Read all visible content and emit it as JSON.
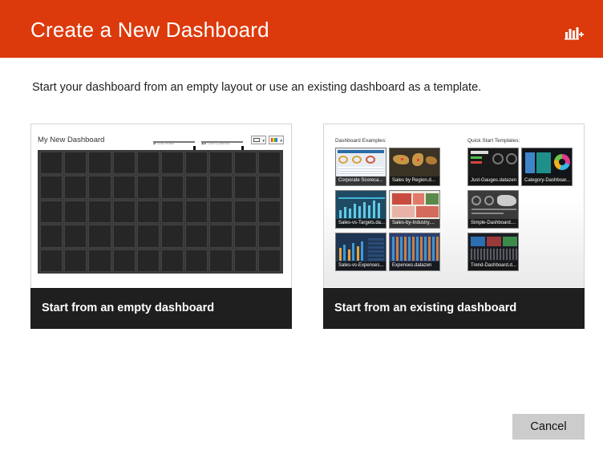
{
  "header": {
    "title": "Create a New Dashboard",
    "icon": "add-chart-icon",
    "color": "#dc3a0c"
  },
  "subtitle": "Start your dashboard from an empty layout or use an existing dashboard as a template.",
  "empty_card": {
    "label": "Start from an empty dashboard",
    "preview": {
      "title": "My New Dashboard",
      "rows_value": "5",
      "rows_caption": "Grid Rows",
      "columns_value": "10",
      "columns_caption": "Grid Columns",
      "grid_rows": 5,
      "grid_columns": 10
    }
  },
  "existing_card": {
    "label": "Start from an existing dashboard",
    "examples_heading": "Dashboard Examples:",
    "templates_heading": "Quick Start Templates:",
    "examples": [
      "Corporate Scoreca...",
      "Sales by Region.d...",
      "Sales-vs-Targets.da...",
      "Sales-by-Industry....",
      "Sales-vs-Expenses...",
      "Expenses.datazen"
    ],
    "templates": [
      "Just-Gauges.datazen",
      "Category-Dashboar...",
      "Simple-Dashboard....",
      "Trend-Dashboard.d..."
    ]
  },
  "footer": {
    "cancel_label": "Cancel"
  }
}
